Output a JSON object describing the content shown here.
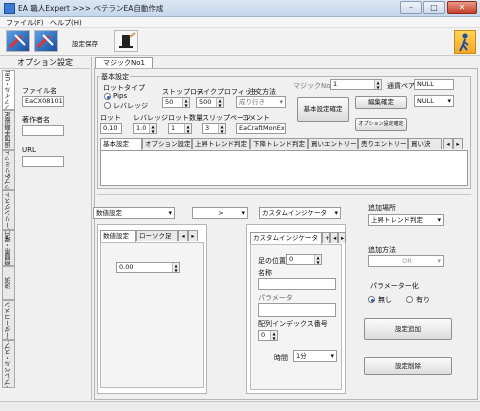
{
  "window": {
    "title": "EA 職人Expert >>> ベテランEA自動作成"
  },
  "menu": {
    "file": "ファイル(F)",
    "help": "ヘルプ(H)"
  },
  "toolbar": {
    "settings_save": "設定保存"
  },
  "left": {
    "title": "オプション設定",
    "vtabs": [
      "ファイル・URL",
      "追加手順設定",
      "ストップ&リミット設定",
      "トレーリングストップ",
      "時間帯・曜日",
      "決済",
      "オーダーコメント",
      "ストップレベル・スプレッド"
    ],
    "file_label": "ファイル名",
    "file_value": "EaCX08101",
    "author_label": "著作者名",
    "author_value": "",
    "url_label": "URL",
    "url_value": ""
  },
  "magic_tab": "マジックNo1",
  "basic": {
    "group_label": "基本設定",
    "lot_type_label": "ロットタイプ",
    "lot_type_options": [
      "Pips",
      "レバレッジ"
    ],
    "stoploss_label": "ストップロス",
    "stoploss_value": "50",
    "takeprofit_label": "テイクプロフィット",
    "takeprofit_value": "500",
    "order_method_label": "注文方法",
    "order_method_value": "成り行き",
    "lot_label": "ロット",
    "lot_value": "0.10",
    "leverage_label": "レバレッジ",
    "leverage_value": "1.0",
    "lot_count_label": "ロット数量",
    "lot_count_value": "1",
    "slippage_label": "スリップページ",
    "slippage_value": "3",
    "comment_label": "コメント",
    "comment_value": "EaCraftMonExpi",
    "magic_label": "マジックNo",
    "magic_value": "1",
    "pair_label": "通貨ペア",
    "pair_value": "NULL",
    "pair2_value": "NULL",
    "confirm_button": "基本設定確定",
    "edit_confirm_button": "編集確定",
    "option_confirm_button": "オプション設定確定"
  },
  "settings_tabs": [
    "基本設定",
    "オプション設定",
    "上昇トレンド判定",
    "下降トレンド判定",
    "買いエントリー",
    "売りエントリー",
    "買い決"
  ],
  "lower": {
    "numeric_select": "数値設定",
    "op_select": ">",
    "custom_select": "カスタムインジケータ",
    "left_tabs": [
      "数値設定",
      "ローソク足"
    ],
    "number_value": "0.00",
    "right_tab": "カスタムインジケータ",
    "shift_label": "足の位置",
    "shift_value": "0",
    "name_label": "名称",
    "name_value": "",
    "param_label": "パラメータ",
    "param_value": "",
    "index_label": "配列インデックス番号",
    "index_value": "0",
    "time_label": "時間",
    "time_value": "1分"
  },
  "side": {
    "add_place_label": "追加場所",
    "add_place_value": "上昇トレンド判定",
    "add_method_label": "追加方法",
    "add_method_value": "OR",
    "param_label": "パラメーター化",
    "param_options": [
      "無し",
      "有り"
    ],
    "add_button": "設定追加",
    "delete_button": "設定削除"
  }
}
